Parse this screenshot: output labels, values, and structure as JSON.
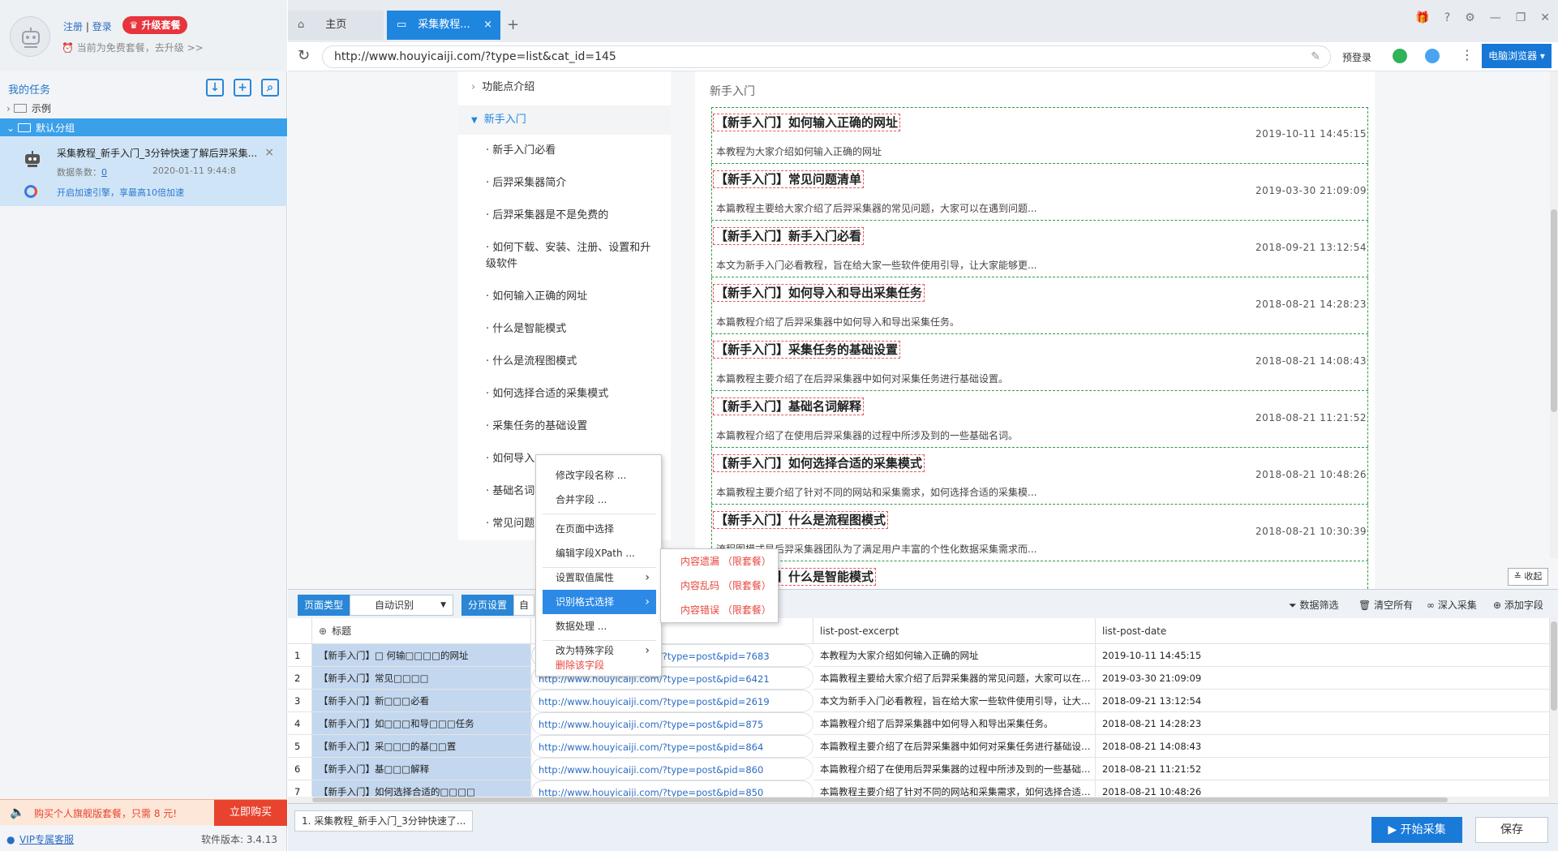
{
  "user": {
    "register": "注册",
    "sep": "|",
    "login": "登录",
    "upgrade": "升级套餐",
    "plan_text": "当前为免费套餐，去升级 >>"
  },
  "tasks": {
    "title": "我的任务",
    "tree": [
      {
        "label": "示例"
      },
      {
        "label": "默认分组"
      }
    ],
    "task": {
      "name": "采集教程_新手入门_3分钟快速了解后羿采集...",
      "count_label": "数据条数：",
      "count": "0",
      "time": "2020-01-11 9:44:8",
      "accel": "开启加速引擎，享最高10倍加速"
    }
  },
  "ad": {
    "text": "购买个人旗舰版套餐，只需 8 元!",
    "button": "立即购买"
  },
  "footer": {
    "vip": "VIP专属客服",
    "version": "软件版本: 3.4.13"
  },
  "tabs": [
    {
      "label": "主页"
    },
    {
      "label": "采集教程..."
    }
  ],
  "address": {
    "url": "http://www.houyicaiji.com/?type=list&cat_id=145",
    "prelogin": "预登录",
    "browser": "电脑浏览器"
  },
  "nav": {
    "items": [
      {
        "label": "功能点介绍",
        "type": "parent"
      },
      {
        "label": "新手入门",
        "type": "open"
      },
      {
        "label": "新手入门必看"
      },
      {
        "label": "后羿采集器简介"
      },
      {
        "label": "后羿采集器是不是免费的"
      },
      {
        "label": "如何下载、安装、注册、设置和升级软件"
      },
      {
        "label": "如何输入正确的网址"
      },
      {
        "label": "什么是智能模式"
      },
      {
        "label": "什么是流程图模式"
      },
      {
        "label": "如何选择合适的采集模式"
      },
      {
        "label": "采集任务的基础设置"
      },
      {
        "label": "如何导入"
      },
      {
        "label": "基础名词"
      },
      {
        "label": "常见问题"
      }
    ]
  },
  "article": {
    "heading": "新手入门",
    "entries": [
      {
        "title": "【新手入门】如何输入正确的网址",
        "date": "2019-10-11 14:45:15",
        "desc": "本教程为大家介绍如何输入正确的网址"
      },
      {
        "title": "【新手入门】常见问题清单",
        "date": "2019-03-30 21:09:09",
        "desc": "本篇教程主要给大家介绍了后羿采集器的常见问题，大家可以在遇到问题..."
      },
      {
        "title": "【新手入门】新手入门必看",
        "date": "2018-09-21 13:12:54",
        "desc": "本文为新手入门必看教程，旨在给大家一些软件使用引导，让大家能够更..."
      },
      {
        "title": "【新手入门】如何导入和导出采集任务",
        "date": "2018-08-21 14:28:23",
        "desc": "本篇教程介绍了后羿采集器中如何导入和导出采集任务。"
      },
      {
        "title": "【新手入门】采集任务的基础设置",
        "date": "2018-08-21 14:08:43",
        "desc": "本篇教程主要介绍了在后羿采集器中如何对采集任务进行基础设置。"
      },
      {
        "title": "【新手入门】基础名词解释",
        "date": "2018-08-21 11:21:52",
        "desc": "本篇教程介绍了在使用后羿采集器的过程中所涉及到的一些基础名词。"
      },
      {
        "title": "【新手入门】如何选择合适的采集模式",
        "date": "2018-08-21 10:48:26",
        "desc": "本篇教程主要介绍了针对不同的网站和采集需求，如何选择合适的采集模..."
      },
      {
        "title": "【新手入门】什么是流程图模式",
        "date": "2018-08-21 10:30:39",
        "desc": "流程图模式是后羿采集器团队为了满足用户丰富的个性化数据采集需求而..."
      },
      {
        "title": "【新手入门】什么是智能模式",
        "date": "",
        "desc": ""
      }
    ],
    "collapse": "收起"
  },
  "menu": {
    "items": [
      {
        "label": "修改字段名称 ..."
      },
      {
        "label": "合并字段 ..."
      },
      {
        "label": "在页面中选择"
      },
      {
        "label": "编辑字段XPath ..."
      },
      {
        "label": "设置取值属性"
      },
      {
        "label": "识别格式选择"
      },
      {
        "label": "数据处理 ..."
      },
      {
        "label": "改为特殊字段"
      },
      {
        "label": "删除该字段"
      }
    ],
    "submenu": [
      {
        "label": "内容遗漏 （限套餐）"
      },
      {
        "label": "内容乱码 （限套餐）"
      },
      {
        "label": "内容错误 （限套餐）"
      }
    ]
  },
  "toolbar": {
    "page_type_label": "页面类型",
    "page_type_value": "自动识别",
    "pager_label": "分页设置",
    "pager_value": "自",
    "filter": "数据筛选",
    "clear": "清空所有",
    "deep": "深入采集",
    "add_field": "添加字段"
  },
  "grid": {
    "headers": [
      "标题",
      "",
      "list-post-excerpt",
      "list-post-date"
    ],
    "rows": [
      {
        "n": "1",
        "title": "【新手入门】□ 何输□□□□的网址",
        "url": "http://www.houyicaiji.com/?type=post&pid=7683",
        "excerpt": "本教程为大家介绍如何输入正确的网址",
        "date": "2019-10-11 14:45:15"
      },
      {
        "n": "2",
        "title": "【新手入门】常见□□□□",
        "url": "http://www.houyicaiji.com/?type=post&pid=6421",
        "excerpt": "本篇教程主要给大家介绍了后羿采集器的常见问题，大家可以在遇到问题时先...",
        "date": "2019-03-30 21:09:09"
      },
      {
        "n": "3",
        "title": "【新手入门】新□□□必看",
        "url": "http://www.houyicaiji.com/?type=post&pid=2619",
        "excerpt": "本文为新手入门必看教程，旨在给大家一些软件使用引导，让大家能够更快地...",
        "date": "2018-09-21 13:12:54"
      },
      {
        "n": "4",
        "title": "【新手入门】如□□□和导□□□任务",
        "url": "http://www.houyicaiji.com/?type=post&pid=875",
        "excerpt": "本篇教程介绍了后羿采集器中如何导入和导出采集任务。",
        "date": "2018-08-21 14:28:23"
      },
      {
        "n": "5",
        "title": "【新手入门】采□□□的基□□置",
        "url": "http://www.houyicaiji.com/?type=post&pid=864",
        "excerpt": "本篇教程主要介绍了在后羿采集器中如何对采集任务进行基础设置。",
        "date": "2018-08-21 14:08:43"
      },
      {
        "n": "6",
        "title": "【新手入门】基□□□解释",
        "url": "http://www.houyicaiji.com/?type=post&pid=860",
        "excerpt": "本篇教程介绍了在使用后羿采集器的过程中所涉及到的一些基础名词。",
        "date": "2018-08-21 11:21:52"
      },
      {
        "n": "7",
        "title": "【新手入门】如何选择合适的□□□□",
        "url": "http://www.houyicaiji.com/?type=post&pid=850",
        "excerpt": "本篇教程主要介绍了针对不同的网站和采集需求，如何选择合适的采集模式。",
        "date": "2018-08-21 10:48:26"
      }
    ]
  },
  "bottom": {
    "task_tab": "1. 采集教程_新手入门_3分钟快速了...",
    "start": "开始采集",
    "save": "保存"
  }
}
